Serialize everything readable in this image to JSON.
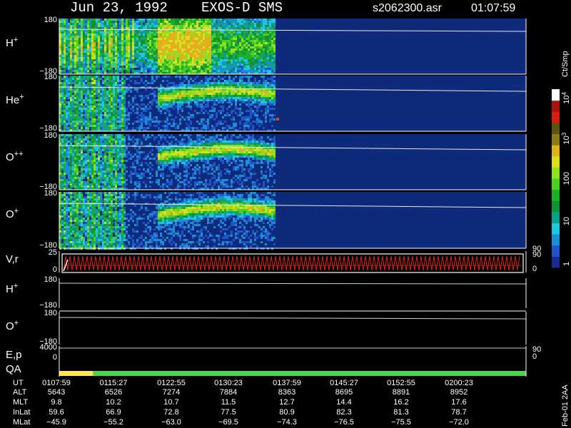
{
  "header": {
    "date": "Jun 23, 1992",
    "instrument": "EXOS-D SMS",
    "file": "s2062300.asr",
    "time": "01:07:59"
  },
  "colorbar": {
    "unit": "Ct/Smp",
    "ticks": [
      {
        "label": "1",
        "value": 1
      },
      {
        "label": "10",
        "value": 10
      },
      {
        "label": "100",
        "value": 100
      },
      {
        "label": "10^3",
        "value": 1000
      },
      {
        "label": "10^4",
        "value": 10000
      }
    ],
    "colors": [
      "#1a2a8e",
      "#1f55c9",
      "#1b8fd6",
      "#1fc6e0",
      "#0fa08a",
      "#138f3a",
      "#1fae2a",
      "#4ccf23",
      "#8fe022",
      "#d7e020",
      "#e0b01e",
      "#8a7a18",
      "#5c5414",
      "#d81d12",
      "#a8140e",
      "#ffffff"
    ]
  },
  "chart_data": [
    {
      "type": "heatmap",
      "panel": "H+ pitch-angle spectrogram",
      "ylabel": "H+",
      "yticks": [
        "180",
        "-180"
      ],
      "ylim": [
        -180,
        180
      ],
      "colorscale": "log Ct/Smp",
      "active_until": "0137:59"
    },
    {
      "type": "heatmap",
      "panel": "He+ pitch-angle spectrogram",
      "ylabel": "He+",
      "yticks": [
        "180",
        "-180"
      ],
      "ylim": [
        -180,
        180
      ],
      "colorscale": "log Ct/Smp",
      "active_until": "0137:59"
    },
    {
      "type": "heatmap",
      "panel": "O++ pitch-angle spectrogram",
      "ylabel": "O++",
      "yticks": [
        "180",
        "-180"
      ],
      "ylim": [
        -180,
        180
      ],
      "colorscale": "log Ct/Smp",
      "active_until": "0137:59"
    },
    {
      "type": "heatmap",
      "panel": "O+ pitch-angle spectrogram",
      "ylabel": "O+",
      "yticks": [
        "180",
        "-180"
      ],
      "ylim": [
        -180,
        180
      ],
      "colorscale": "log Ct/Smp",
      "active_until": "0137:59",
      "right_ticks": [
        "90"
      ]
    },
    {
      "type": "line",
      "panel": "V,r",
      "ylabel": "V,r",
      "yticks": [
        "25",
        "0"
      ],
      "ylim": [
        0,
        25
      ],
      "right_ticks": [
        "90",
        "0"
      ]
    },
    {
      "type": "line",
      "panel": "H+ (second)",
      "ylabel": "H+",
      "yticks": [
        "180",
        "-180"
      ],
      "ylim": [
        -180,
        180
      ]
    },
    {
      "type": "line",
      "panel": "O+ (second)",
      "ylabel": "O+",
      "yticks": [
        "180",
        "-180"
      ],
      "ylim": [
        -180,
        180
      ]
    },
    {
      "type": "line",
      "panel": "E,p",
      "ylabel": "E,p",
      "yticks": [
        "4000",
        "0"
      ],
      "ylim": [
        0,
        4000
      ],
      "right_ticks": [
        "90",
        "0"
      ]
    },
    {
      "type": "bar",
      "panel": "QA",
      "ylabel": "QA",
      "segments": [
        {
          "start": "0107:59",
          "end": "0112:00",
          "color": "#ffe64a"
        },
        {
          "start": "0112:00",
          "end": "0203:00",
          "color": "#44d84a"
        }
      ]
    }
  ],
  "time_table": {
    "labels": [
      "UT",
      "ALT",
      "MLT",
      "InLat",
      "MLat"
    ],
    "columns": [
      {
        "UT": "0107:59",
        "ALT": "5643",
        "MLT": "9.8",
        "InLat": "59.6",
        "MLat": "-45.9"
      },
      {
        "UT": "0115:27",
        "ALT": "6526",
        "MLT": "10.2",
        "InLat": "66.9",
        "MLat": "-55.2"
      },
      {
        "UT": "0122:55",
        "ALT": "7274",
        "MLT": "10.7",
        "InLat": "72.8",
        "MLat": "-63.0"
      },
      {
        "UT": "0130:23",
        "ALT": "7884",
        "MLT": "11.5",
        "InLat": "77.5",
        "MLat": "-69.5"
      },
      {
        "UT": "0137:59",
        "ALT": "8363",
        "MLT": "12.7",
        "InLat": "80.9",
        "MLat": "-74.3"
      },
      {
        "UT": "0145:27",
        "ALT": "8695",
        "MLT": "14.4",
        "InLat": "82.3",
        "MLat": "-76.5"
      },
      {
        "UT": "0152:55",
        "ALT": "8891",
        "MLT": "16.2",
        "InLat": "81.3",
        "MLat": "-75.5"
      },
      {
        "UT": "0200:23",
        "ALT": "8952",
        "MLT": "17.6",
        "InLat": "78.7",
        "MLat": "-72.0"
      }
    ]
  },
  "footer_stamp": "Feb-01 2AA"
}
